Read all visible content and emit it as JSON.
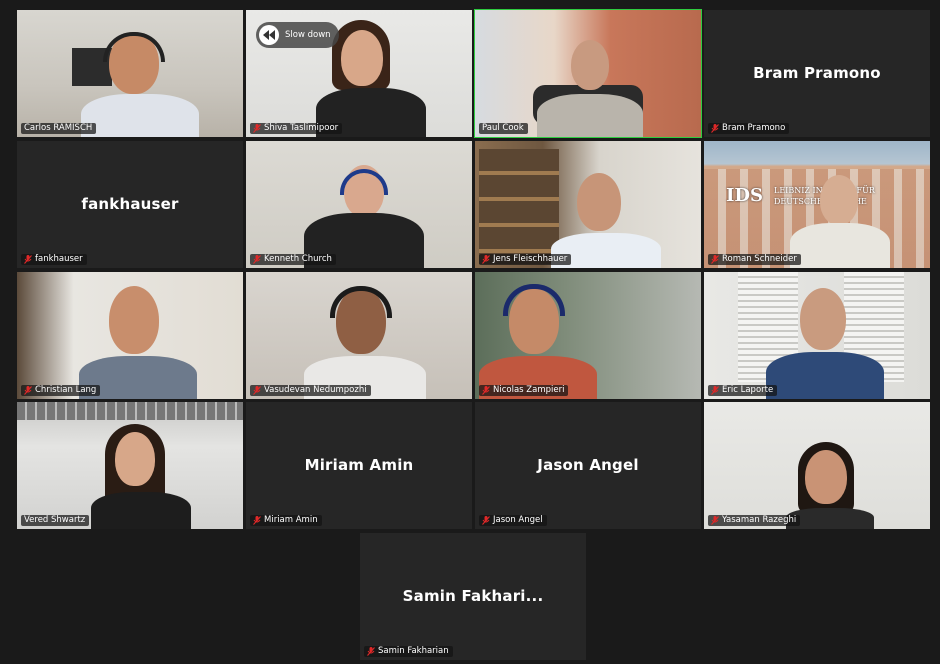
{
  "colors": {
    "background": "#1a1a1a",
    "tile": "#262626",
    "active_border": "#2ecc40",
    "muted_mic": "#e02828"
  },
  "overlay": {
    "slow_down_label": "Slow down",
    "icon": "rewind-icon"
  },
  "participants": [
    {
      "name": "Carlos RAMISCH",
      "video": true,
      "muted": false
    },
    {
      "name": "Shiva Taslimipoor",
      "video": true,
      "muted": true
    },
    {
      "name": "Paul Cook",
      "video": true,
      "muted": false,
      "active_speaker": true
    },
    {
      "name": "Bram Pramono",
      "display": "Bram Pramono",
      "video": false,
      "muted": true
    },
    {
      "name": "fankhauser",
      "display": "fankhauser",
      "video": false,
      "muted": true
    },
    {
      "name": "Kenneth Church",
      "video": true,
      "muted": true
    },
    {
      "name": "Jens Fleischhauer",
      "video": true,
      "muted": true
    },
    {
      "name": "Roman Schneider",
      "video": true,
      "muted": true,
      "background_text": "IDS  LEIBNIZ INSTITUT FÜR DEUTSCHE SPRACHE"
    },
    {
      "name": "Christian Lang",
      "video": true,
      "muted": true
    },
    {
      "name": "Vasudevan Nedumpozhi",
      "video": true,
      "muted": true
    },
    {
      "name": "Nicolas Zampieri",
      "video": true,
      "muted": true
    },
    {
      "name": "Eric Laporte",
      "video": true,
      "muted": true
    },
    {
      "name": "Vered Shwartz",
      "video": true,
      "muted": false
    },
    {
      "name": "Miriam Amin",
      "display": "Miriam Amin",
      "video": false,
      "muted": true
    },
    {
      "name": "Jason Angel",
      "display": "Jason Angel",
      "video": false,
      "muted": true
    },
    {
      "name": "Yasaman Razeghi",
      "video": true,
      "muted": true
    },
    {
      "name": "Samin Fakharian",
      "display": "Samin Fakhari...",
      "video": false,
      "muted": true
    }
  ]
}
